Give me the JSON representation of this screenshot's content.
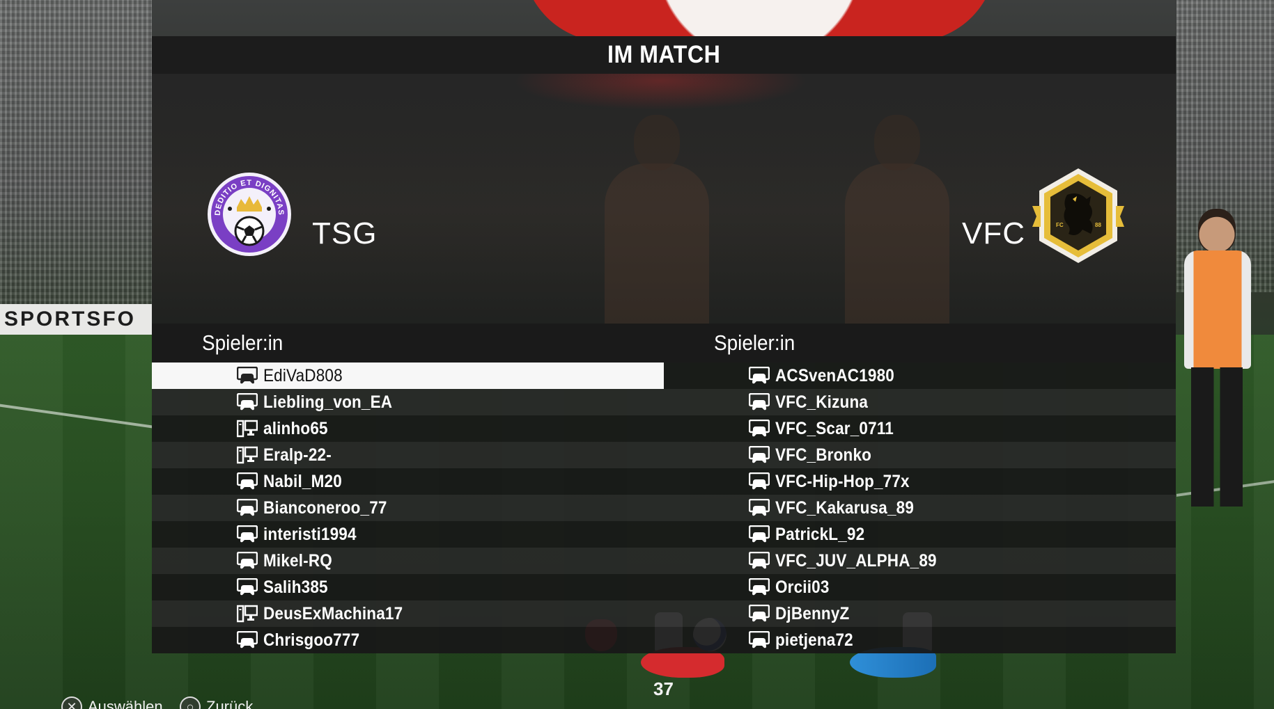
{
  "screen": {
    "title": "IM MATCH",
    "match_timer": "37"
  },
  "background": {
    "board_text": "SPORTSFO"
  },
  "teams": {
    "home": {
      "name": "TSG",
      "crest_text": "DEDITIO ET DIGNITAS",
      "crest_icon": "crown-football-badge",
      "color": "#7a3fc4"
    },
    "away": {
      "name": "VFC",
      "crest_text_left": "FC",
      "crest_text_right": "88",
      "crest_icon": "griffin-hexagon-badge",
      "color": "#e6bd3a"
    }
  },
  "columns": {
    "home_header": "Spieler:in",
    "away_header": "Spieler:in"
  },
  "home_players": [
    {
      "name": "EdiVaD808",
      "platform": "console-icon",
      "selected": true
    },
    {
      "name": "Liebling_von_EA",
      "platform": "console-icon",
      "selected": false
    },
    {
      "name": "alinho65",
      "platform": "pc-icon",
      "selected": false
    },
    {
      "name": "Eralp-22-",
      "platform": "pc-icon",
      "selected": false
    },
    {
      "name": "Nabil_M20",
      "platform": "console-icon",
      "selected": false
    },
    {
      "name": "Bianconeroo_77",
      "platform": "console-icon",
      "selected": false
    },
    {
      "name": "interisti1994",
      "platform": "console-icon",
      "selected": false
    },
    {
      "name": "Mikel-RQ",
      "platform": "console-icon",
      "selected": false
    },
    {
      "name": "Salih385",
      "platform": "console-icon",
      "selected": false
    },
    {
      "name": "DeusExMachina17",
      "platform": "pc-icon",
      "selected": false
    },
    {
      "name": "Chrisgoo777",
      "platform": "console-icon",
      "selected": false
    }
  ],
  "away_players": [
    {
      "name": "ACSvenAC1980",
      "platform": "console-icon"
    },
    {
      "name": "VFC_Kizuna",
      "platform": "console-icon"
    },
    {
      "name": "VFC_Scar_0711",
      "platform": "console-icon"
    },
    {
      "name": "VFC_Bronko",
      "platform": "console-icon"
    },
    {
      "name": "VFC-Hip-Hop_77x",
      "platform": "console-icon"
    },
    {
      "name": "VFC_Kakarusa_89",
      "platform": "console-icon"
    },
    {
      "name": "PatrickL_92",
      "platform": "console-icon"
    },
    {
      "name": "VFC_JUV_ALPHA_89",
      "platform": "console-icon"
    },
    {
      "name": "Orcii03",
      "platform": "console-icon"
    },
    {
      "name": "DjBennyZ",
      "platform": "console-icon"
    },
    {
      "name": "pietjena72",
      "platform": "console-icon"
    }
  ],
  "footer": {
    "select_label": "Auswählen",
    "select_glyph": "✕",
    "back_label": "Zurück",
    "back_glyph": "○"
  },
  "colors": {
    "panel_header": "#1c1c1c",
    "row_selected": "#f7f7f7",
    "row_odd": "#181818",
    "row_even": "#282828"
  }
}
